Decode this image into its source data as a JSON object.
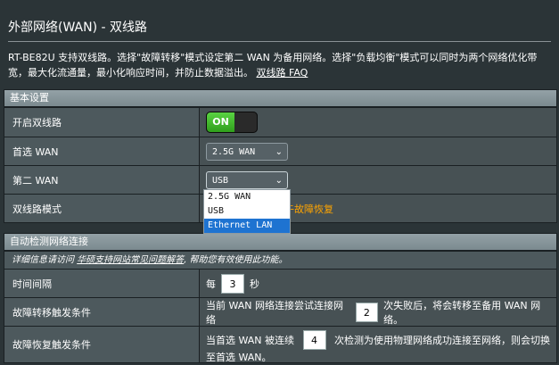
{
  "page": {
    "title": "外部网络(WAN) - 双线路",
    "description": "RT-BE82U 支持双线路。选择\"故障转移\"模式设定第二 WAN 为备用网络。选择\"负载均衡\"模式可以同时为两个网络优化带宽，最大化流通量，最小化响应时间，并防止数据溢出。",
    "faq_link": "双线路 FAQ"
  },
  "basic": {
    "header": "基本设置",
    "enable_label": "开启双线路",
    "enable_state": "ON",
    "primary_label": "首选 WAN",
    "primary_value": "2.5G WAN",
    "secondary_label": "第二 WAN",
    "secondary_value": "USB",
    "mode_label": "双线路模式",
    "mode_value_partial": "午故障恢复",
    "dropdown_options": [
      "2.5G WAN",
      "USB",
      "Ethernet LAN"
    ],
    "dropdown_selected": "Ethernet LAN"
  },
  "detect": {
    "header": "自动检测网络连接",
    "info_prefix": "详细信息请访问 ",
    "info_link": "华硕支持网站常见问题解答",
    "info_suffix": ", 帮助您有效使用此功能。",
    "interval_label": "时间间隔",
    "interval_prefix": "每",
    "interval_value": "3",
    "interval_unit": "秒",
    "failover_label": "故障转移触发条件",
    "failover_prefix": "当前 WAN 网络连接尝试连接网络",
    "failover_value": "2",
    "failover_suffix": "次失败后，将会转移至备用 WAN 网络。",
    "failback_label": "故障恢复触发条件",
    "failback_prefix": "当首选 WAN 被连续",
    "failback_value": "4",
    "failback_suffix": "次检测为使用物理网络成功连接至网络，则会切换至首选 WAN。"
  }
}
